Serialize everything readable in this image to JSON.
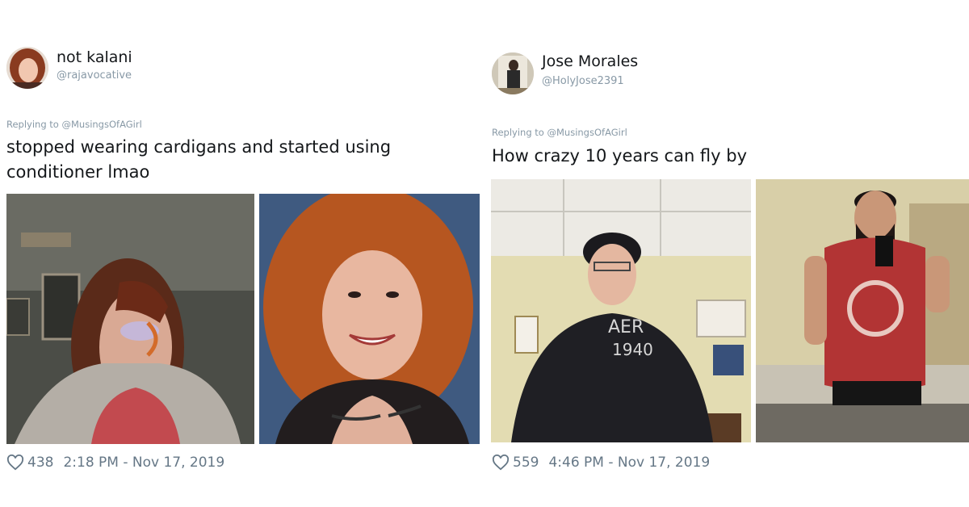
{
  "tweets": [
    {
      "display_name": "not kalani",
      "handle": "@rajavocative",
      "replying_to": "Replying to @MusingsOfAGirl",
      "text_line1": "stopped wearing cardigans and started using",
      "text_line2": "conditioner lmao",
      "likes": "438",
      "timestamp": "2:18 PM - Nov 17, 2019",
      "photos": [
        "before-photo",
        "after-photo"
      ]
    },
    {
      "display_name": "Jose Morales",
      "handle": "@HolyJose2391",
      "replying_to": "Replying to @MusingsOfAGirl",
      "text_line1": "How crazy 10 years can fly by",
      "likes": "559",
      "timestamp": "4:46 PM - Nov 17, 2019",
      "photos": [
        "before-photo",
        "after-photo"
      ]
    }
  ],
  "icons": {
    "like": "heart-icon"
  },
  "colors": {
    "text": "#14171a",
    "secondary": "#8899a6",
    "meta": "#657786"
  }
}
